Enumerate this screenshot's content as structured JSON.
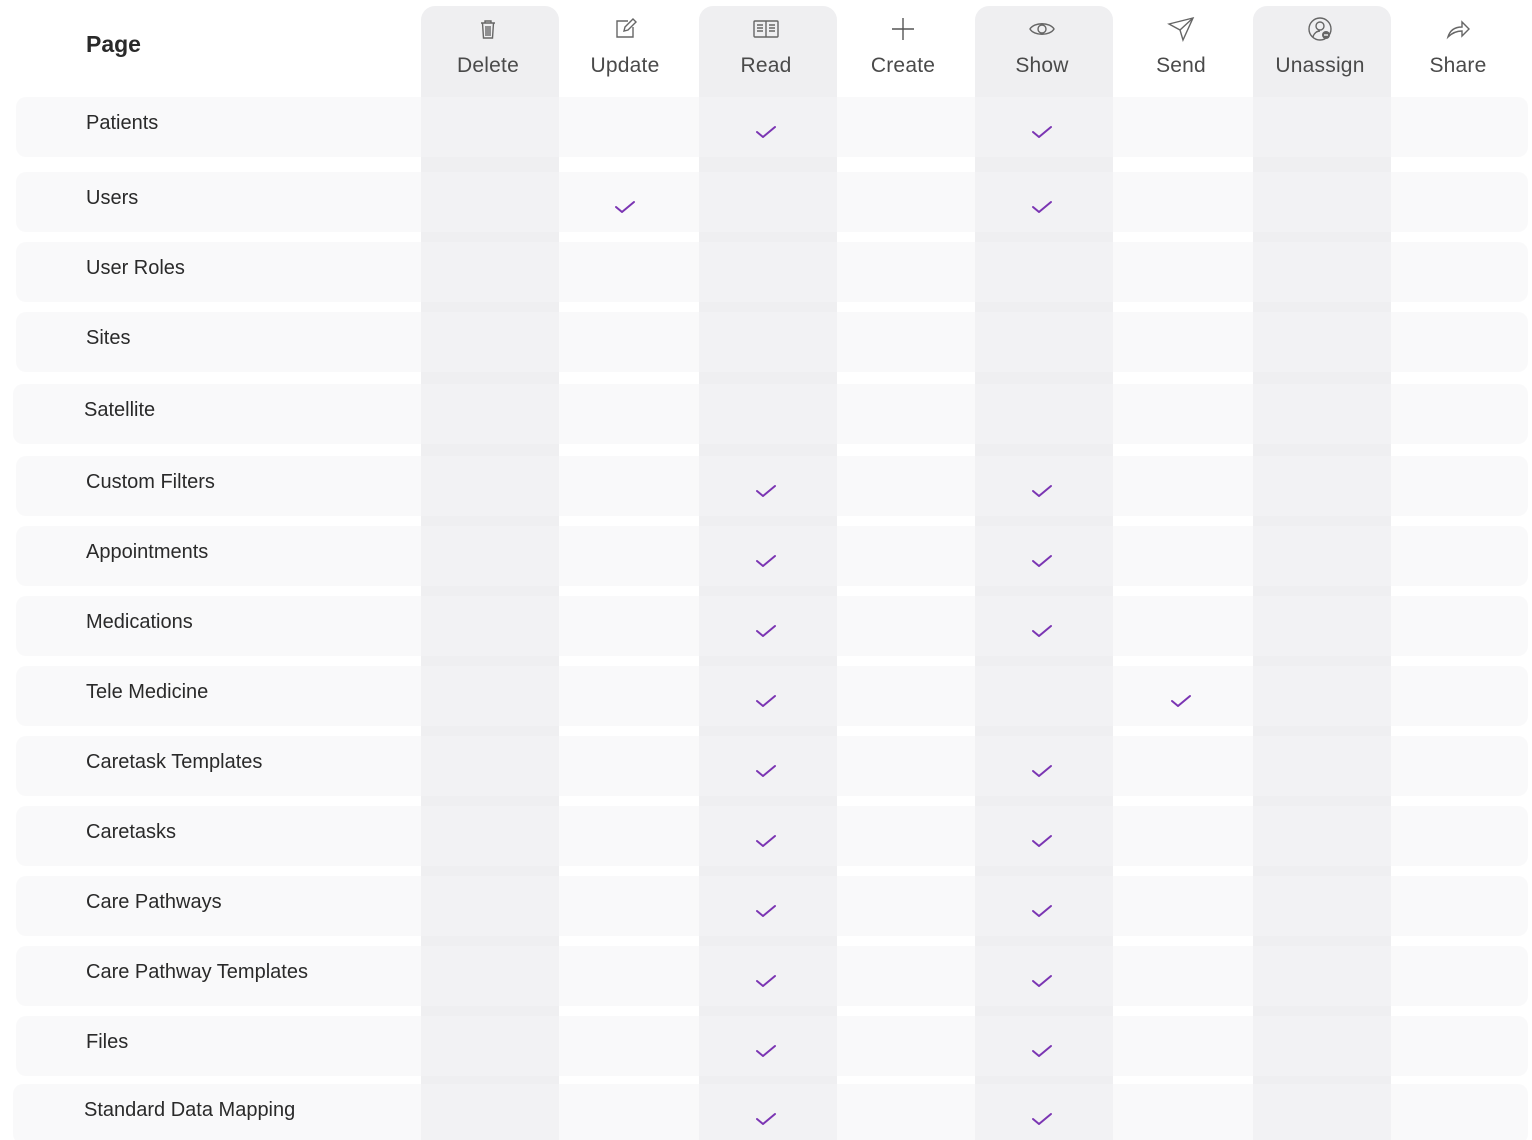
{
  "header": {
    "page_label": "Page"
  },
  "colors": {
    "check": "#7b35b3",
    "column_shade": "#efeff1",
    "row_bg": "#f5f5f7",
    "text": "#2a2a2a"
  },
  "permissions": [
    {
      "key": "delete",
      "label": "Delete",
      "icon": "trash-icon"
    },
    {
      "key": "update",
      "label": "Update",
      "icon": "edit-icon"
    },
    {
      "key": "read",
      "label": "Read",
      "icon": "book-icon"
    },
    {
      "key": "create",
      "label": "Create",
      "icon": "plus-icon"
    },
    {
      "key": "show",
      "label": "Show",
      "icon": "eye-icon"
    },
    {
      "key": "send",
      "label": "Send",
      "icon": "paper-plane-icon"
    },
    {
      "key": "unassign",
      "label": "Unassign",
      "icon": "user-remove-icon"
    },
    {
      "key": "share",
      "label": "Share",
      "icon": "share-icon"
    }
  ],
  "pages": [
    {
      "name": "Patients",
      "checked": [
        "read",
        "show"
      ]
    },
    {
      "name": "Users",
      "checked": [
        "update",
        "show"
      ]
    },
    {
      "name": "User Roles",
      "checked": []
    },
    {
      "name": "Sites",
      "checked": []
    },
    {
      "name": "Satellite",
      "checked": []
    },
    {
      "name": "Custom Filters",
      "checked": [
        "read",
        "show"
      ]
    },
    {
      "name": "Appointments",
      "checked": [
        "read",
        "show"
      ]
    },
    {
      "name": "Medications",
      "checked": [
        "read",
        "show"
      ]
    },
    {
      "name": "Tele Medicine",
      "checked": [
        "read",
        "send"
      ]
    },
    {
      "name": "Caretask Templates",
      "checked": [
        "read",
        "show"
      ]
    },
    {
      "name": "Caretasks",
      "checked": [
        "read",
        "show"
      ]
    },
    {
      "name": "Care Pathways",
      "checked": [
        "read",
        "show"
      ]
    },
    {
      "name": "Care Pathway Templates",
      "checked": [
        "read",
        "show"
      ]
    },
    {
      "name": "Files",
      "checked": [
        "read",
        "show"
      ]
    },
    {
      "name": "Standard Data Mapping",
      "checked": [
        "read",
        "show"
      ]
    }
  ]
}
